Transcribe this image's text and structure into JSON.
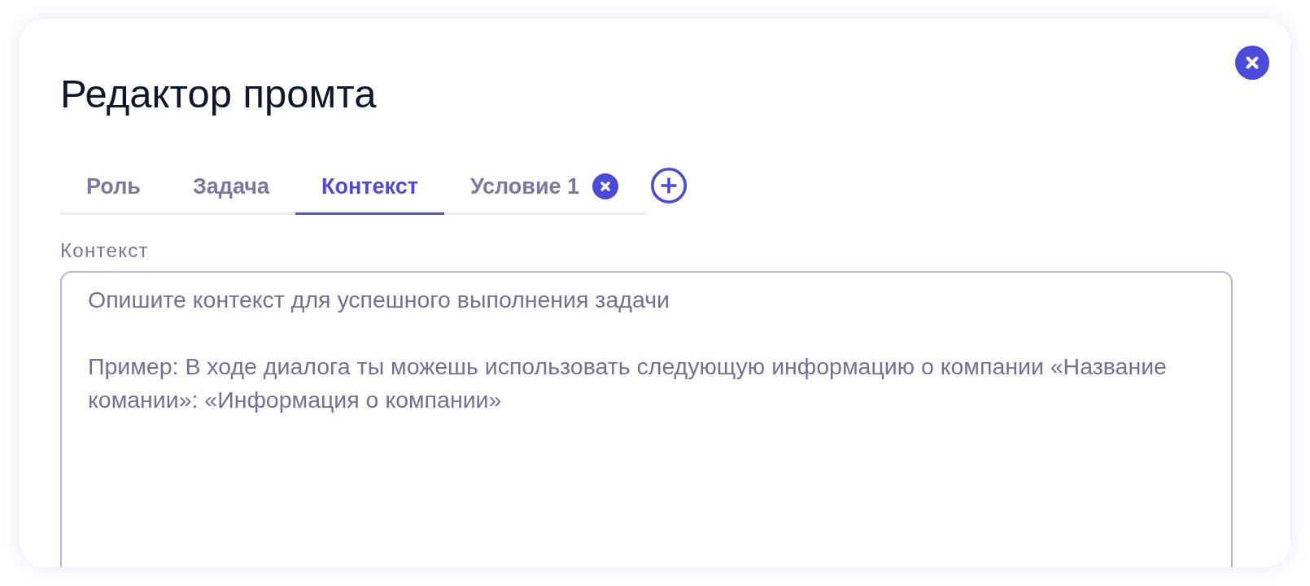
{
  "dialog": {
    "title": "Редактор промта"
  },
  "tabs": [
    {
      "label": "Роль",
      "selected": false,
      "removable": false
    },
    {
      "label": "Задача",
      "selected": false,
      "removable": false
    },
    {
      "label": "Контекст",
      "selected": true,
      "removable": false
    },
    {
      "label": "Условие 1",
      "selected": false,
      "removable": true
    }
  ],
  "field": {
    "label": "Контекст",
    "placeholder": "Опишите контекст для успешного выполнения задачи\n\nПример: В ходе диалога ты можешь использовать следующую информацию о компании «Название комании»: «Информация о компании»"
  }
}
